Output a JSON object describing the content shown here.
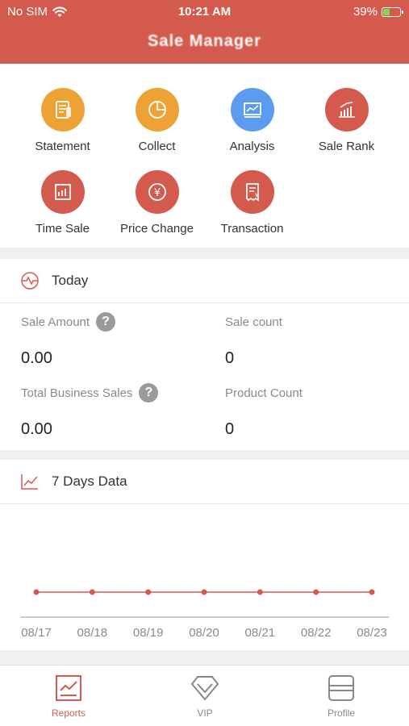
{
  "status_bar": {
    "carrier": "No SIM",
    "time": "10:21 AM",
    "battery": "39%",
    "battery_level": 0.39
  },
  "header": {
    "title": "Sale Manager"
  },
  "menu": [
    {
      "label": "Statement",
      "icon": "statement-icon",
      "color": "#eea236"
    },
    {
      "label": "Collect",
      "icon": "pie-chart-icon",
      "color": "#eea236"
    },
    {
      "label": "Analysis",
      "icon": "analysis-icon",
      "color": "#5b9bf0"
    },
    {
      "label": "Sale Rank",
      "icon": "rank-icon",
      "color": "#d45a4d"
    },
    {
      "label": "Time Sale",
      "icon": "time-sale-icon",
      "color": "#d45a4d"
    },
    {
      "label": "Price Change",
      "icon": "yen-icon",
      "color": "#d45a4d"
    },
    {
      "label": "Transaction",
      "icon": "receipt-icon",
      "color": "#d45a4d"
    }
  ],
  "today": {
    "title": "Today",
    "stats": [
      {
        "label": "Sale Amount",
        "value": "0.00",
        "help": true
      },
      {
        "label": "Sale count",
        "value": "0",
        "help": false
      },
      {
        "label": "Total Business Sales",
        "value": "0.00",
        "help": true
      },
      {
        "label": "Product Count",
        "value": "0",
        "help": false
      }
    ]
  },
  "seven_days": {
    "title": "7 Days Data"
  },
  "chart_data": {
    "type": "line",
    "categories": [
      "08/17",
      "08/18",
      "08/19",
      "08/20",
      "08/21",
      "08/22",
      "08/23"
    ],
    "series": [
      {
        "values": [
          0,
          0,
          0,
          0,
          0,
          0,
          0
        ]
      }
    ],
    "color": "#d45a4d"
  },
  "tabs": [
    {
      "label": "Reports",
      "active": true
    },
    {
      "label": "VIP",
      "active": false
    },
    {
      "label": "Profile",
      "active": false
    }
  ],
  "colors": {
    "brand": "#d45a4d",
    "orange": "#eea236",
    "blue": "#5b9bf0"
  }
}
